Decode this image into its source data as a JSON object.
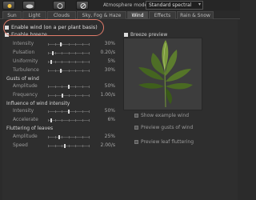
{
  "toolbar": {
    "atmosphere_label": "Atmosphere model:",
    "atmosphere_value": "Standard spectral",
    "icons": [
      "sun-icon",
      "cloud-icon",
      "lens-icon",
      "disabled-icon"
    ]
  },
  "tabs": [
    {
      "label": "Sun"
    },
    {
      "label": "Light"
    },
    {
      "label": "Clouds"
    },
    {
      "label": "Sky, Fog & Haze"
    },
    {
      "label": "Wind",
      "active": true
    },
    {
      "label": "Effects"
    },
    {
      "label": "Rain & Snow"
    }
  ],
  "wind": {
    "enable_wind_label": "Enable wind (on a per plant basis)",
    "enable_breeze_label": "Enable breeze",
    "breeze": [
      {
        "label": "Intensity",
        "value": "30%",
        "fraction": 0.3
      },
      {
        "label": "Pulsation",
        "value": "0.20/s",
        "fraction": 0.1
      },
      {
        "label": "Uniformity",
        "value": "5%",
        "fraction": 0.05
      },
      {
        "label": "Turbulence",
        "value": "30%",
        "fraction": 0.3
      }
    ],
    "gusts_header": "Gusts of wind",
    "gusts": [
      {
        "label": "Amplitude",
        "value": "50%",
        "fraction": 0.5
      },
      {
        "label": "Frequency",
        "value": "1.00/s",
        "fraction": 0.33
      }
    ],
    "influence_header": "Influence of wind intensity",
    "influence": [
      {
        "label": "Intensity",
        "value": "50%",
        "fraction": 0.5
      },
      {
        "label": "Accelerate",
        "value": "6%",
        "fraction": 0.06
      }
    ],
    "flutter_header": "Fluttering of leaves",
    "flutter": [
      {
        "label": "Amplitude",
        "value": "25%",
        "fraction": 0.25
      },
      {
        "label": "Speed",
        "value": "2.00/s",
        "fraction": 0.4
      }
    ],
    "preview_label": "Breeze preview",
    "preview_options": [
      "Show example wind",
      "Preview gusts of wind",
      "Preview leaf fluttering"
    ]
  }
}
